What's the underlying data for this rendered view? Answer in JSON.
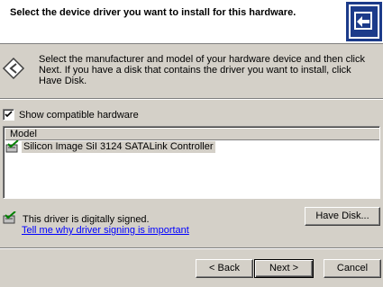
{
  "header": {
    "title": "Select the device driver you want to install for this hardware."
  },
  "intro": {
    "text": "Select the manufacturer and model of your hardware device and then click Next. If you have a disk that contains the driver you want to install, click Have Disk."
  },
  "compatible": {
    "label": "Show compatible hardware",
    "checked": true
  },
  "model_list": {
    "header": "Model",
    "items": [
      "Silicon Image SiI 3124 SATALink Controller"
    ]
  },
  "signing": {
    "status": "This driver is digitally signed.",
    "link": "Tell me why driver signing is important"
  },
  "buttons": {
    "have_disk": "Have Disk...",
    "back": "< Back",
    "next": "Next >",
    "cancel": "Cancel"
  },
  "colors": {
    "dialog_bg": "#d4d0c8",
    "link": "#0000ff",
    "header_icon_bg": "#1c3b8a"
  },
  "icons": {
    "header": "hardware-wizard-icon",
    "intro": "hardware-arrow-icon",
    "model_item": "signed-driver-icon",
    "signed": "signed-driver-icon"
  }
}
